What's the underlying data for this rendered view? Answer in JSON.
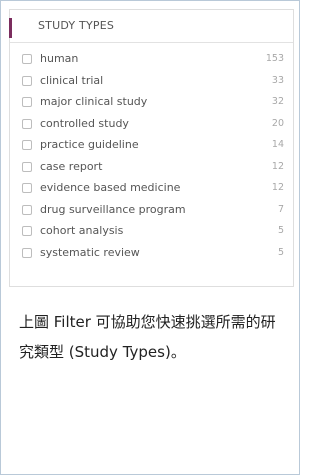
{
  "filter": {
    "title": "STUDY TYPES",
    "items": [
      {
        "label": "human",
        "count": "153"
      },
      {
        "label": "clinical trial",
        "count": "33"
      },
      {
        "label": "major clinical study",
        "count": "32"
      },
      {
        "label": "controlled study",
        "count": "20"
      },
      {
        "label": "practice guideline",
        "count": "14"
      },
      {
        "label": "case report",
        "count": "12"
      },
      {
        "label": "evidence based medicine",
        "count": "12"
      },
      {
        "label": "drug surveillance program",
        "count": "7"
      },
      {
        "label": "cohort analysis",
        "count": "5"
      },
      {
        "label": "systematic review",
        "count": "5"
      }
    ]
  },
  "caption": "上圖 Filter 可協助您快速挑選所需的研究類型 (Study Types)。",
  "colors": {
    "accent": "#7b2d5e",
    "frame_border": "#b9c9d8"
  }
}
